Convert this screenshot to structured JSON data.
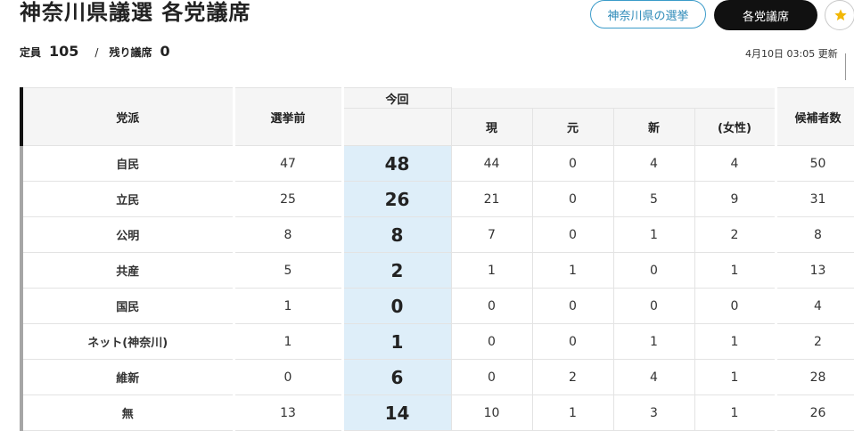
{
  "header": {
    "title": "神奈川県議選 各党議席",
    "btn_prefecture": "神奈川県の選挙",
    "btn_seats": "各党議席"
  },
  "summary": {
    "capacity_label": "定員",
    "capacity_value": "105",
    "separator": "/",
    "remaining_label": "残り議席",
    "remaining_value": "0",
    "timestamp": "4月10日 03:05 更新"
  },
  "table": {
    "headers": {
      "party": "党派",
      "before": "選挙前",
      "this_time": "今回",
      "incumbent": "現",
      "former": "元",
      "new": "新",
      "female": "(女性)",
      "candidates": "候補者数"
    },
    "rows": [
      {
        "party": "自民",
        "before": "47",
        "now": "48",
        "incumbent": "44",
        "former": "0",
        "new": "4",
        "female": "4",
        "candidates": "50"
      },
      {
        "party": "立民",
        "before": "25",
        "now": "26",
        "incumbent": "21",
        "former": "0",
        "new": "5",
        "female": "9",
        "candidates": "31"
      },
      {
        "party": "公明",
        "before": "8",
        "now": "8",
        "incumbent": "7",
        "former": "0",
        "new": "1",
        "female": "2",
        "candidates": "8"
      },
      {
        "party": "共産",
        "before": "5",
        "now": "2",
        "incumbent": "1",
        "former": "1",
        "new": "0",
        "female": "1",
        "candidates": "13"
      },
      {
        "party": "国民",
        "before": "1",
        "now": "0",
        "incumbent": "0",
        "former": "0",
        "new": "0",
        "female": "0",
        "candidates": "4"
      },
      {
        "party": "ネット(神奈川)",
        "before": "1",
        "now": "1",
        "incumbent": "0",
        "former": "0",
        "new": "1",
        "female": "1",
        "candidates": "2"
      },
      {
        "party": "維新",
        "before": "0",
        "now": "6",
        "incumbent": "0",
        "former": "2",
        "new": "4",
        "female": "1",
        "candidates": "28"
      },
      {
        "party": "無",
        "before": "13",
        "now": "14",
        "incumbent": "10",
        "former": "1",
        "new": "3",
        "female": "1",
        "candidates": "26"
      }
    ]
  }
}
